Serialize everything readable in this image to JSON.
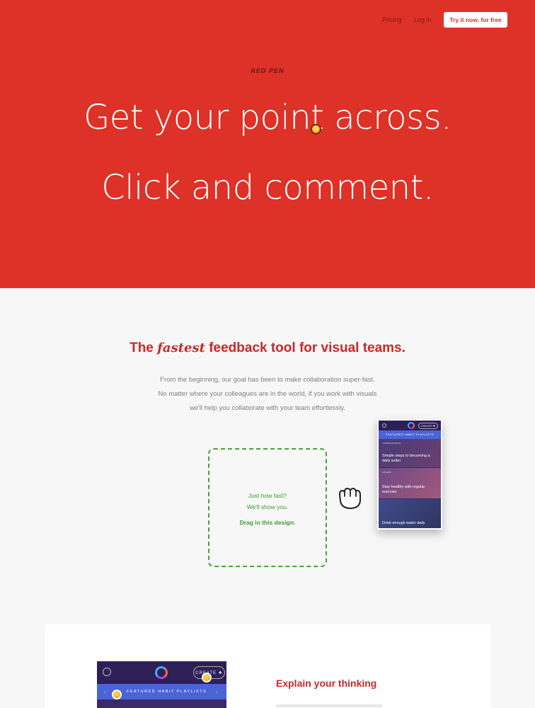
{
  "nav": {
    "pricing": "Pricing",
    "login": "Log in",
    "cta": "Try it now, for free"
  },
  "hero": {
    "brand": "RED PEN",
    "headline_1": "Get your point across.",
    "headline_2": "Click and comment."
  },
  "intro": {
    "title_before": "The",
    "title_em": "fastest",
    "title_after": "feedback tool for visual teams.",
    "paragraph_lines": [
      "From the beginning, our goal has been to make collaboration super-fast.",
      "No matter where your colleagues are in the world, if you work with visuals",
      "we'll help you collaborate with your team effortlessly."
    ]
  },
  "demo": {
    "dropzone_line_1": "Just how fast?",
    "dropzone_line_2": "We'll show you.",
    "dropzone_action": "Drag in this design.",
    "hand_icon": "grab-hand-icon",
    "phone": {
      "create": "CREATE ✚",
      "band": "FEATURED HABIT PLAYLISTS",
      "cards": [
        {
          "label": "COMMUNICATION",
          "text": "Simple steps to becoming a daily writer"
        },
        {
          "label": "FITNESS",
          "text": "Stay healthy with regular exercise"
        },
        {
          "label": "",
          "text": "Drink enough water daily"
        }
      ]
    }
  },
  "feature": {
    "create": "CREATE ✚",
    "band": "FEATURED HABIT PLAYLISTS",
    "title": "Explain your thinking"
  },
  "colors": {
    "hero_red": "#de3127",
    "accent_red": "#c8282a",
    "green": "#4aa03c",
    "pin_orange": "#f39a18"
  }
}
